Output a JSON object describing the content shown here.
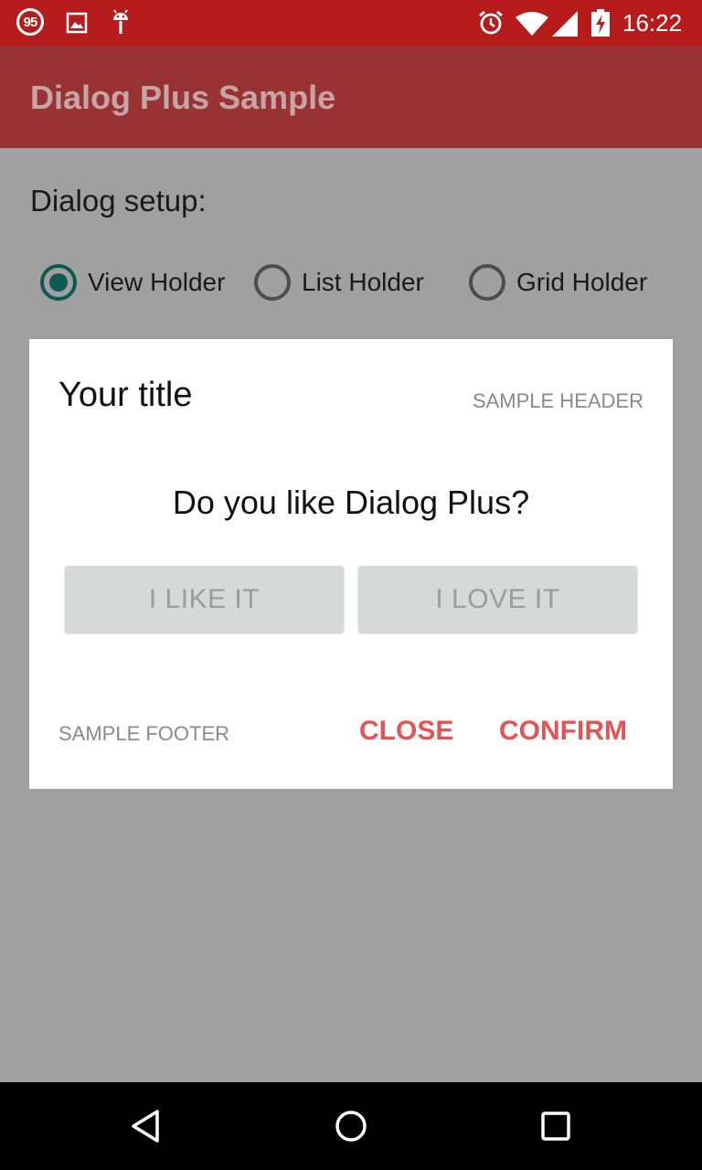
{
  "status_bar": {
    "notification_count": "95",
    "time": "16:22",
    "icons": [
      "notification-badge-icon",
      "image-icon",
      "android-icon",
      "alarm-icon",
      "wifi-icon",
      "signal-icon",
      "battery-charging-icon"
    ]
  },
  "app_bar": {
    "title": "Dialog Plus Sample"
  },
  "content": {
    "setup_label": "Dialog setup:",
    "radio_options": [
      {
        "label": "View Holder",
        "checked": true
      },
      {
        "label": "List Holder",
        "checked": false
      },
      {
        "label": "Grid Holder",
        "checked": false
      }
    ]
  },
  "dialog": {
    "title": "Your title",
    "header": "SAMPLE HEADER",
    "question": "Do you like Dialog Plus?",
    "choice_left": "I LIKE IT",
    "choice_right": "I LOVE IT",
    "footer": "SAMPLE FOOTER",
    "close_label": "CLOSE",
    "confirm_label": "CONFIRM"
  },
  "nav_bar": {
    "icons": [
      "back-icon",
      "home-icon",
      "recents-icon"
    ]
  },
  "colors": {
    "status_bar": "#b71c1c",
    "app_bar": "#993333",
    "scrim": "#a0a0a0",
    "accent_radio": "#0d5a52",
    "action_text": "#e05555"
  }
}
